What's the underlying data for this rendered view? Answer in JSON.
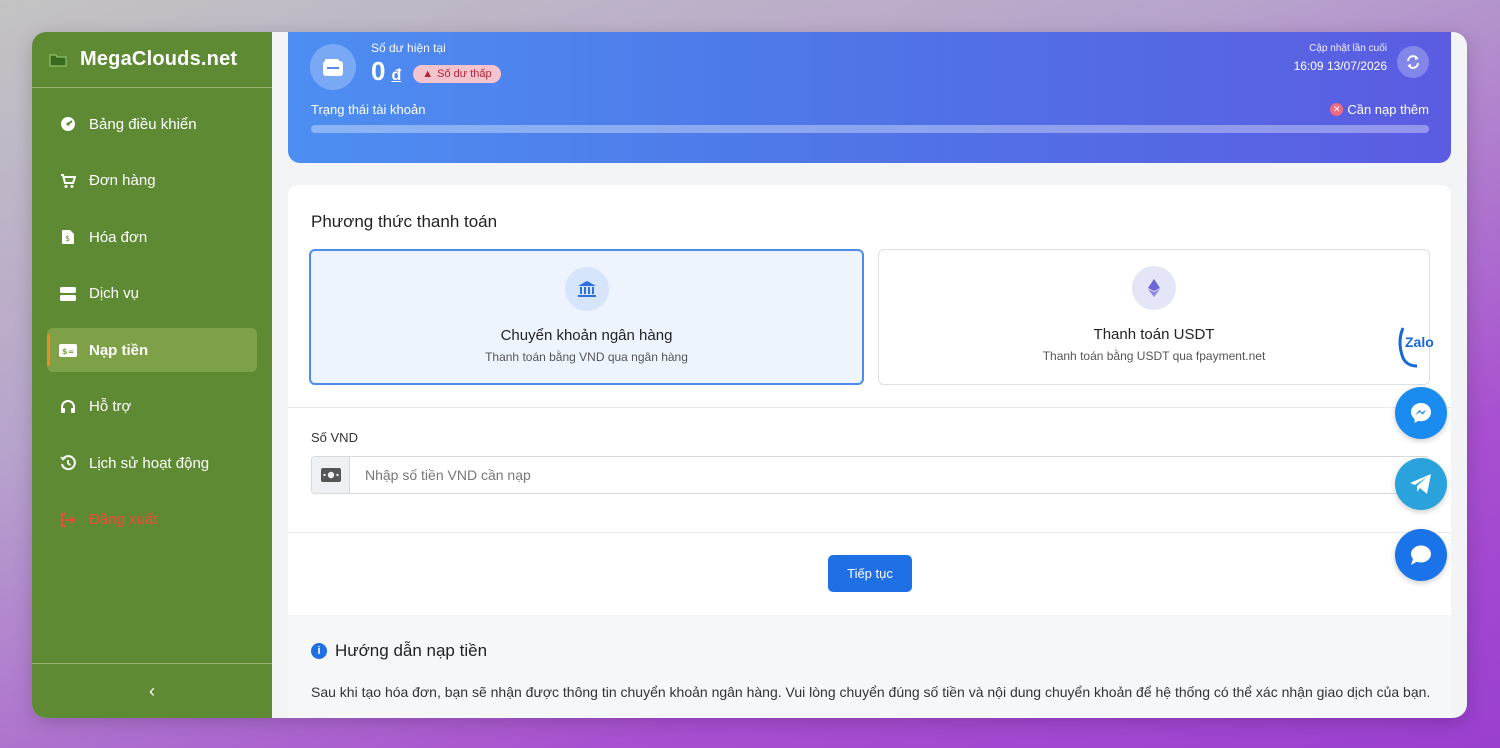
{
  "sidebar": {
    "brand": "MegaClouds.net",
    "items": [
      {
        "label": "Bảng điều khiển",
        "icon": "dashboard-icon"
      },
      {
        "label": "Đơn hàng",
        "icon": "cart-icon"
      },
      {
        "label": "Hóa đơn",
        "icon": "invoice-icon"
      },
      {
        "label": "Dịch vụ",
        "icon": "server-icon"
      },
      {
        "label": "Nạp tiền",
        "icon": "money-icon",
        "active": true
      },
      {
        "label": "Hỗ trợ",
        "icon": "headset-icon"
      },
      {
        "label": "Lịch sử hoạt động",
        "icon": "history-icon"
      },
      {
        "label": "Đăng xuất",
        "icon": "logout-icon"
      }
    ],
    "collapse": "‹"
  },
  "balance": {
    "label": "Số dư hiện tại",
    "amount": "0",
    "currency": "đ",
    "low_badge": "Số dư thấp",
    "update_label": "Cập nhật lần cuối",
    "update_time": "16:09 13/07/2026",
    "status_label": "Trạng thái tài khoản",
    "status_value": "Cần nạp thêm",
    "progress": 0
  },
  "payment": {
    "title": "Phương thức thanh toán",
    "methods": [
      {
        "title": "Chuyển khoản ngân hàng",
        "subtitle": "Thanh toán bằng VND qua ngân hàng",
        "icon": "bank-icon",
        "selected": true
      },
      {
        "title": "Thanh toán USDT",
        "subtitle": "Thanh toán bằng USDT qua fpayment.net",
        "icon": "ethereum-icon",
        "selected": false
      }
    ],
    "amount_label": "Số VND",
    "amount_placeholder": "Nhập số tiền VND cần nạp",
    "continue_label": "Tiếp tục"
  },
  "guide": {
    "title": "Hướng dẫn nạp tiền",
    "text": "Sau khi tạo hóa đơn, bạn sẽ nhận được thông tin chuyển khoản ngân hàng. Vui lòng chuyển đúng số tiền và nội dung chuyển khoản để hệ thống có thể xác nhận giao dịch của bạn."
  },
  "contacts": {
    "zalo_label": "Zalo",
    "colors": {
      "messenger": "#1a8cf0",
      "telegram": "#2aa3dc",
      "chat": "#1a73e8"
    }
  },
  "colors": {
    "sidebar_bg": "#5e8a34",
    "active_item": "#7ea046",
    "primary": "#1f6fe5",
    "logout": "#f04a3a"
  }
}
